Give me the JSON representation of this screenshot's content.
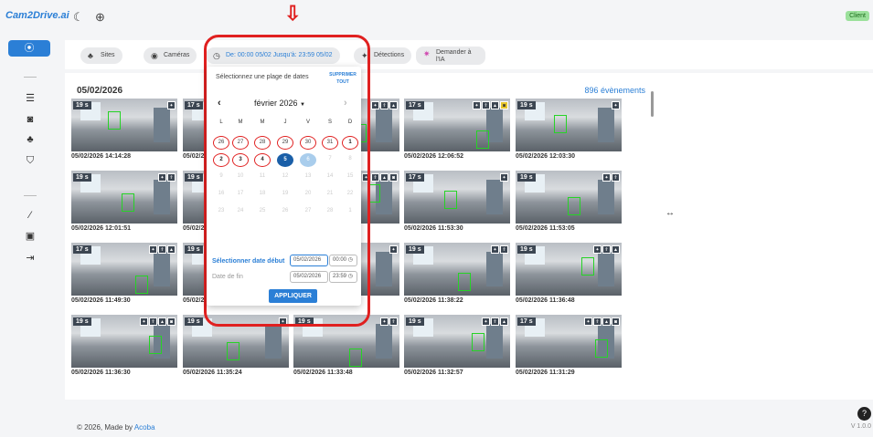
{
  "header": {
    "logo": "Cam2Drive.ai",
    "badge": "Client",
    "theme_icon": "moon-icon",
    "language_icon": "globe-icon"
  },
  "filters": {
    "sites": "Sites",
    "cameras": "Caméras",
    "date_range": "De: 00:00 05/02 Jusqu'à: 23:59 05/02",
    "detections": "Détections",
    "ask_ai": "Demander à l'IA"
  },
  "gallery": {
    "date_heading": "05/02/2026",
    "event_count": "896 évènements",
    "cards": [
      {
        "label": "19 s",
        "time": "05/02/2026 14:14:28"
      },
      {
        "label": "17 s",
        "time": "05/02/20"
      },
      {
        "label": "",
        "time": ""
      },
      {
        "label": "17 s",
        "time": "05/02/2026 12:06:52"
      },
      {
        "label": "19 s",
        "time": "05/02/2026 12:03:30"
      },
      {
        "label": "19 s",
        "time": "05/02/2026 12:01:51"
      },
      {
        "label": "19 s",
        "time": "05/02/20"
      },
      {
        "label": "",
        "time": ""
      },
      {
        "label": "17 s",
        "time": "05/02/2026 11:53:30"
      },
      {
        "label": "19 s",
        "time": "05/02/2026 11:53:05"
      },
      {
        "label": "17 s",
        "time": "05/02/2026 11:49:30"
      },
      {
        "label": "19 s",
        "time": "05/02/20"
      },
      {
        "label": "",
        "time": ""
      },
      {
        "label": "19 s",
        "time": "05/02/2026 11:38:22"
      },
      {
        "label": "19 s",
        "time": "05/02/2026 11:36:48"
      },
      {
        "label": "19 s",
        "time": "05/02/2026 11:36:30"
      },
      {
        "label": "19 s",
        "time": "05/02/2026 11:35:24"
      },
      {
        "label": "19 s",
        "time": "05/02/2026 11:33:48"
      },
      {
        "label": "19 s",
        "time": "05/02/2026 11:32:57"
      },
      {
        "label": "17 s",
        "time": "05/02/2026 11:31:29"
      }
    ]
  },
  "calendar": {
    "title": "Sélectionnez une plage de dates",
    "clear": "SUPPRIMER TOUT",
    "month": "février 2026",
    "weekdays": [
      "L",
      "M",
      "M",
      "J",
      "V",
      "S",
      "D"
    ],
    "days": [
      "26",
      "27",
      "28",
      "29",
      "30",
      "31",
      "1",
      "2",
      "3",
      "4",
      "5",
      "6",
      "7",
      "8",
      "9",
      "10",
      "11",
      "12",
      "13",
      "14",
      "15",
      "16",
      "17",
      "18",
      "19",
      "20",
      "21",
      "22",
      "23",
      "24",
      "25",
      "26",
      "27",
      "28",
      "1"
    ],
    "start_label": "Sélectionner date début",
    "start_date": "05/02/2026",
    "start_time": "00:00",
    "end_label": "Date de fin",
    "end_date": "05/02/2026",
    "end_time": "23:59",
    "apply": "APPLIQUER"
  },
  "footer": {
    "text": "© 2026, Made by ",
    "link": "Acoba",
    "version": "V 1.0.0"
  }
}
